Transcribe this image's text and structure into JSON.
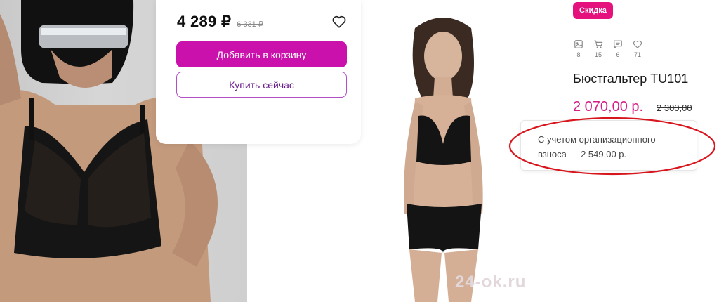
{
  "buy_card": {
    "price": "4 289 ₽",
    "old_price": "6 331 ₽",
    "add_to_cart_label": "Добавить в корзину",
    "buy_now_label": "Купить сейчас"
  },
  "product": {
    "badge": "Скидка",
    "stats": [
      {
        "icon": "photo-icon",
        "count": "8"
      },
      {
        "icon": "cart-icon",
        "count": "15"
      },
      {
        "icon": "comment-icon",
        "count": "6"
      },
      {
        "icon": "heart-icon",
        "count": "71"
      }
    ],
    "title": "Бюстгальтер TU101",
    "price": "2 070,00 р.",
    "old_price": "2 300,00",
    "fee_note_line1": "С учетом организационного",
    "fee_note_line2": "взноса — 2 549,00 р."
  },
  "watermark": "24-ok.ru",
  "colors": {
    "primary_button": "#cb11ab",
    "badge": "#e5127e",
    "price_accent": "#d41d87",
    "annotation_circle": "#d8141c"
  }
}
